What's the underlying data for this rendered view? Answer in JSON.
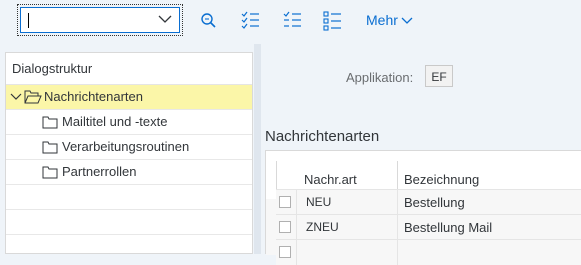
{
  "toolbar": {
    "select_value": "",
    "more_label": "Mehr",
    "icons": [
      "chevron-down-icon",
      "search-icon",
      "select-all-icon",
      "deselect-all-icon",
      "list-details-icon"
    ]
  },
  "dialog": {
    "header": "Dialogstruktur",
    "items": [
      {
        "label": "Nachrichtenarten",
        "selected": true,
        "expanded": true
      },
      {
        "label": "Mailtitel und -texte"
      },
      {
        "label": "Verarbeitungsroutinen"
      },
      {
        "label": "Partnerrollen"
      }
    ]
  },
  "form": {
    "app_label": "Applikation:",
    "app_value": "EF"
  },
  "section": {
    "title": "Nachrichtenarten"
  },
  "table": {
    "columns": [
      "Nachr.art",
      "Bezeichnung"
    ],
    "rows": [
      {
        "code": "NEU",
        "text": "Bestellung"
      },
      {
        "code": "ZNEU",
        "text": "Bestellung Mail"
      },
      {
        "code": "",
        "text": ""
      }
    ]
  },
  "colors": {
    "accent": "#0a6ed1",
    "selection": "#fbf6a8",
    "background": "#eff4f9"
  }
}
